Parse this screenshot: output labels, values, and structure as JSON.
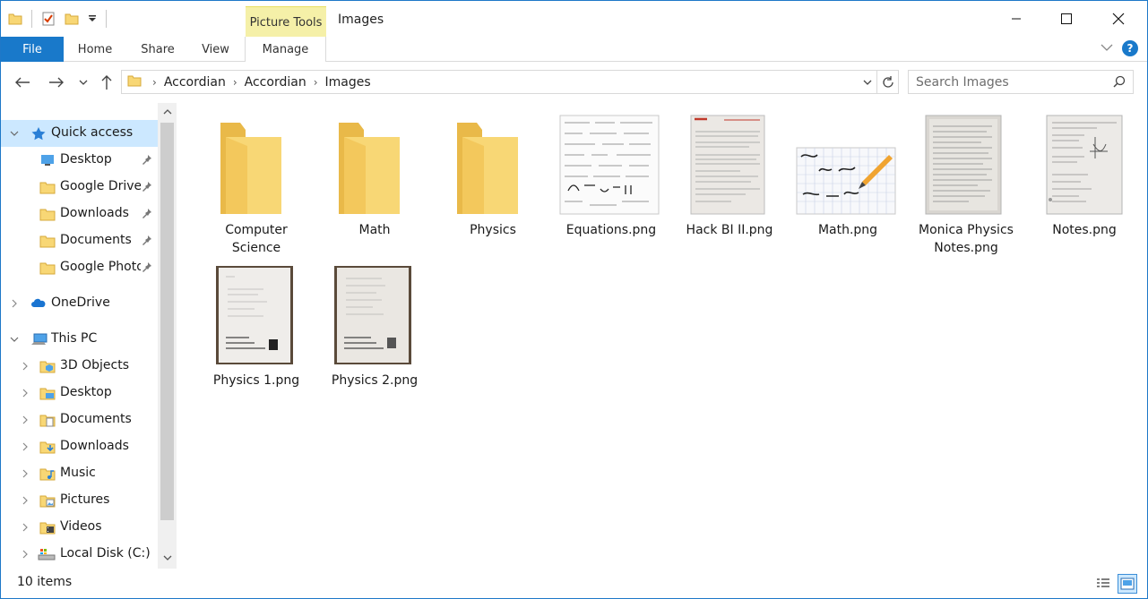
{
  "window": {
    "title": "Images",
    "context_tab": "Picture Tools"
  },
  "ribbon": {
    "tabs": [
      {
        "label": "File"
      },
      {
        "label": "Home"
      },
      {
        "label": "Share"
      },
      {
        "label": "View"
      },
      {
        "label": "Manage"
      }
    ]
  },
  "address": {
    "crumbs": [
      "Accordian",
      "Accordian",
      "Images"
    ]
  },
  "search": {
    "placeholder": "Search Images"
  },
  "nav": {
    "items": [
      {
        "label": "Quick access",
        "icon": "star-icon"
      },
      {
        "label": "Desktop",
        "icon": "desktop-folder-icon"
      },
      {
        "label": "Google Drive",
        "icon": "folder-icon"
      },
      {
        "label": "Downloads",
        "icon": "folder-icon"
      },
      {
        "label": "Documents",
        "icon": "folder-icon"
      },
      {
        "label": "Google Photos",
        "icon": "folder-icon"
      },
      {
        "label": "OneDrive",
        "icon": "cloud-icon"
      },
      {
        "label": "This PC",
        "icon": "computer-icon"
      },
      {
        "label": "3D Objects",
        "icon": "3d-objects-icon"
      },
      {
        "label": "Desktop",
        "icon": "desktop-folder-icon"
      },
      {
        "label": "Documents",
        "icon": "documents-folder-icon"
      },
      {
        "label": "Downloads",
        "icon": "downloads-folder-icon"
      },
      {
        "label": "Music",
        "icon": "music-folder-icon"
      },
      {
        "label": "Pictures",
        "icon": "pictures-folder-icon"
      },
      {
        "label": "Videos",
        "icon": "videos-folder-icon"
      },
      {
        "label": "Local Disk (C:)",
        "icon": "drive-icon"
      }
    ]
  },
  "files": {
    "items": [
      {
        "label": "Computer Science",
        "kind": "folder"
      },
      {
        "label": "Math",
        "kind": "folder"
      },
      {
        "label": "Physics",
        "kind": "folder"
      },
      {
        "label": "Equations.png",
        "kind": "image"
      },
      {
        "label": "Hack BI II.png",
        "kind": "image"
      },
      {
        "label": "Math.png",
        "kind": "image"
      },
      {
        "label": "Monica Physics Notes.png",
        "kind": "image"
      },
      {
        "label": "Notes.png",
        "kind": "image"
      },
      {
        "label": "Physics 1.png",
        "kind": "image"
      },
      {
        "label": "Physics 2.png",
        "kind": "image"
      }
    ]
  },
  "status": {
    "item_count": "10 items"
  },
  "colors": {
    "accent": "#1979ca",
    "folder": "#f8d775",
    "selection": "#cce8ff",
    "context_tab": "#f5f0a8"
  }
}
